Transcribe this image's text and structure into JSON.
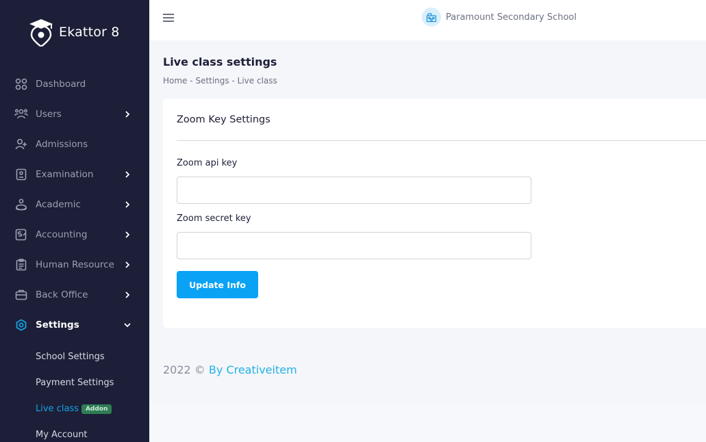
{
  "app": {
    "name": "Ekattor 8"
  },
  "colors": {
    "sidebar_bg": "#1c1f37",
    "accent": "#0aa2f5",
    "link": "#24b1e6",
    "badge_bg": "#2f7d56"
  },
  "sidebar": {
    "items": [
      {
        "label": "Dashboard",
        "icon": "dashboard-grid-icon",
        "has_children": false
      },
      {
        "label": "Users",
        "icon": "users-icon",
        "has_children": true
      },
      {
        "label": "Admissions",
        "icon": "user-plus-icon",
        "has_children": false
      },
      {
        "label": "Examination",
        "icon": "exam-document-icon",
        "has_children": true
      },
      {
        "label": "Academic",
        "icon": "academic-icon",
        "has_children": true
      },
      {
        "label": "Accounting",
        "icon": "accounting-icon",
        "has_children": true
      },
      {
        "label": "Human Resource",
        "icon": "clipboard-icon",
        "has_children": true
      },
      {
        "label": "Back Office",
        "icon": "briefcase-icon",
        "has_children": true
      },
      {
        "label": "Settings",
        "icon": "gear-icon",
        "has_children": true,
        "expanded": true,
        "active": true
      }
    ],
    "settings_children": [
      {
        "label": "School Settings"
      },
      {
        "label": "Payment Settings"
      },
      {
        "label": "Live class",
        "badge": "Addon",
        "active": true
      },
      {
        "label": "My Account"
      }
    ]
  },
  "header": {
    "school_name": "Paramount Secondary School"
  },
  "page": {
    "title": "Live class settings",
    "breadcrumb": [
      "Home",
      "Settings",
      "Live class"
    ],
    "breadcrumb_sep": "-"
  },
  "card": {
    "title": "Zoom Key Settings",
    "fields": [
      {
        "label": "Zoom api key",
        "value": "",
        "placeholder": ""
      },
      {
        "label": "Zoom secret key",
        "value": "",
        "placeholder": ""
      }
    ],
    "submit_label": "Update Info"
  },
  "footer": {
    "text": "2022 ©",
    "link_text": "By Creativeitem"
  }
}
